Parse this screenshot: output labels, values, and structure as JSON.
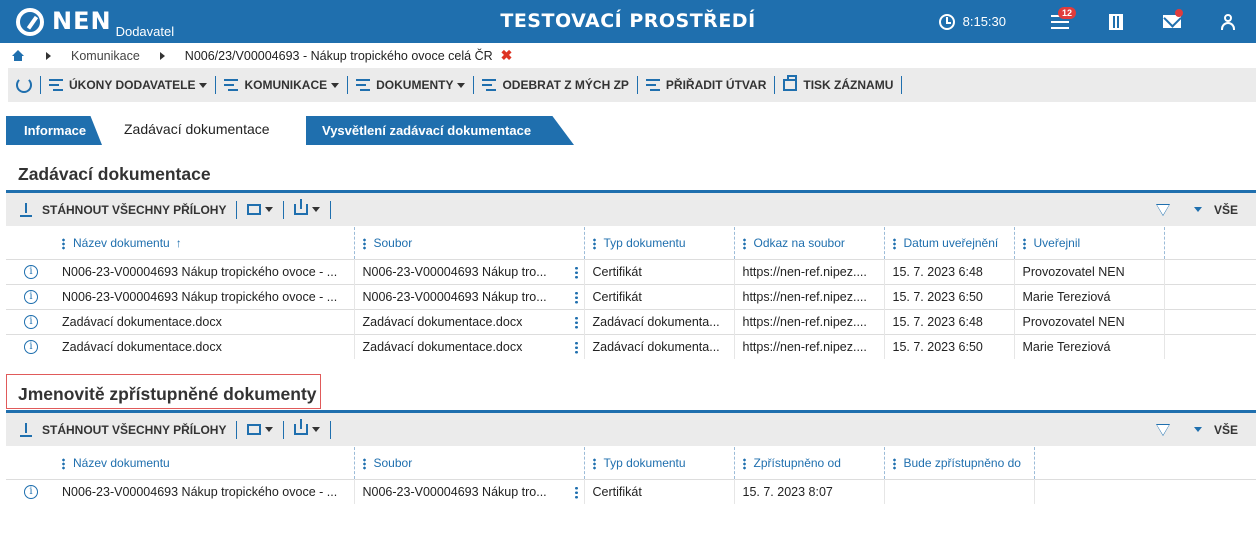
{
  "header": {
    "logo_text": "NEN",
    "logo_sub": "Dodavatel",
    "env_title": "TESTOVACÍ PROSTŘEDÍ",
    "time": "8:15:30",
    "notification_count": "12",
    "color": "#1f6fae"
  },
  "breadcrumb": {
    "link": "Komunikace",
    "current": "N006/23/V00004693 - Nákup tropického ovoce celá ČR",
    "close": "✖"
  },
  "toolbar": {
    "items": [
      "ÚKONY DODAVATELE",
      "KOMUNIKACE",
      "DOKUMENTY",
      "ODEBRAT Z MÝCH ZP",
      "PŘIŘADIT ÚTVAR",
      "TISK ZÁZNAMU"
    ]
  },
  "tabs": [
    "Informace",
    "Zadávací dokumentace",
    "Vysvětlení zadávací dokumentace"
  ],
  "section1": {
    "title": "Zadávací dokumentace",
    "download_all": "STÁHNOUT VŠECHNY PŘÍLOHY",
    "all_label": "VŠE",
    "columns": [
      "Název dokumentu",
      "Soubor",
      "Typ dokumentu",
      "Odkaz na soubor",
      "Datum uveřejnění",
      "Uveřejnil"
    ],
    "sort_indicator": "↑",
    "rows": [
      [
        "N006-23-V00004693 Nákup tropického ovoce - ...",
        "N006-23-V00004693 Nákup tro...",
        "Certifikát",
        "https://nen-ref.nipez....",
        "15. 7. 2023 6:48",
        "Provozovatel NEN"
      ],
      [
        "N006-23-V00004693 Nákup tropického ovoce - ...",
        "N006-23-V00004693 Nákup tro...",
        "Certifikát",
        "https://nen-ref.nipez....",
        "15. 7. 2023 6:50",
        "Marie Tereziová"
      ],
      [
        "Zadávací dokumentace.docx",
        "Zadávací dokumentace.docx",
        "Zadávací dokumenta...",
        "https://nen-ref.nipez....",
        "15. 7. 2023 6:48",
        "Provozovatel NEN"
      ],
      [
        "Zadávací dokumentace.docx",
        "Zadávací dokumentace.docx",
        "Zadávací dokumenta...",
        "https://nen-ref.nipez....",
        "15. 7. 2023 6:50",
        "Marie Tereziová"
      ]
    ]
  },
  "section2": {
    "title": "Jmenovitě zpřístupněné dokumenty",
    "download_all": "STÁHNOUT VŠECHNY PŘÍLOHY",
    "all_label": "VŠE",
    "columns": [
      "Název dokumentu",
      "Soubor",
      "Typ dokumentu",
      "Zpřístupněno od",
      "Bude zpřístupněno do"
    ],
    "rows": [
      [
        "N006-23-V00004693 Nákup tropického ovoce - ...",
        "N006-23-V00004693 Nákup tro...",
        "Certifikát",
        "15. 7. 2023 8:07",
        ""
      ]
    ]
  },
  "icons": {
    "info": "i"
  }
}
